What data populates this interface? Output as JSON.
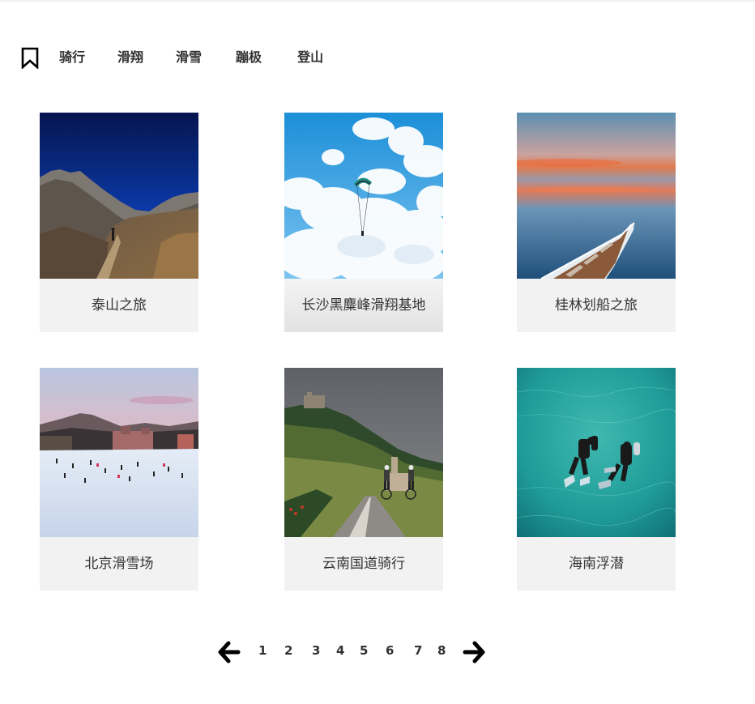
{
  "categories": [
    "骑行",
    "滑翔",
    "滑雪",
    "蹦极",
    "登山"
  ],
  "icons": {
    "bookmark": "bookmark-icon",
    "prev": "arrow-left-icon",
    "next": "arrow-right-icon"
  },
  "cards": [
    {
      "title": "泰山之旅",
      "image": "mountain-trail-photo"
    },
    {
      "title": "长沙黑麋峰滑翔基地",
      "image": "paraglider-sky-photo"
    },
    {
      "title": "桂林划船之旅",
      "image": "boat-sunset-lake-photo"
    },
    {
      "title": "北京滑雪场",
      "image": "ski-resort-photo"
    },
    {
      "title": "云南国道骑行",
      "image": "road-cyclists-photo"
    },
    {
      "title": "海南浮潜",
      "image": "scuba-divers-photo"
    }
  ],
  "pagination": {
    "pages": [
      "1",
      "2",
      "3",
      "4",
      "5",
      "6",
      "7",
      "8"
    ]
  },
  "colors": {
    "caption_bg": "#f2f2f2",
    "text": "#333333"
  }
}
